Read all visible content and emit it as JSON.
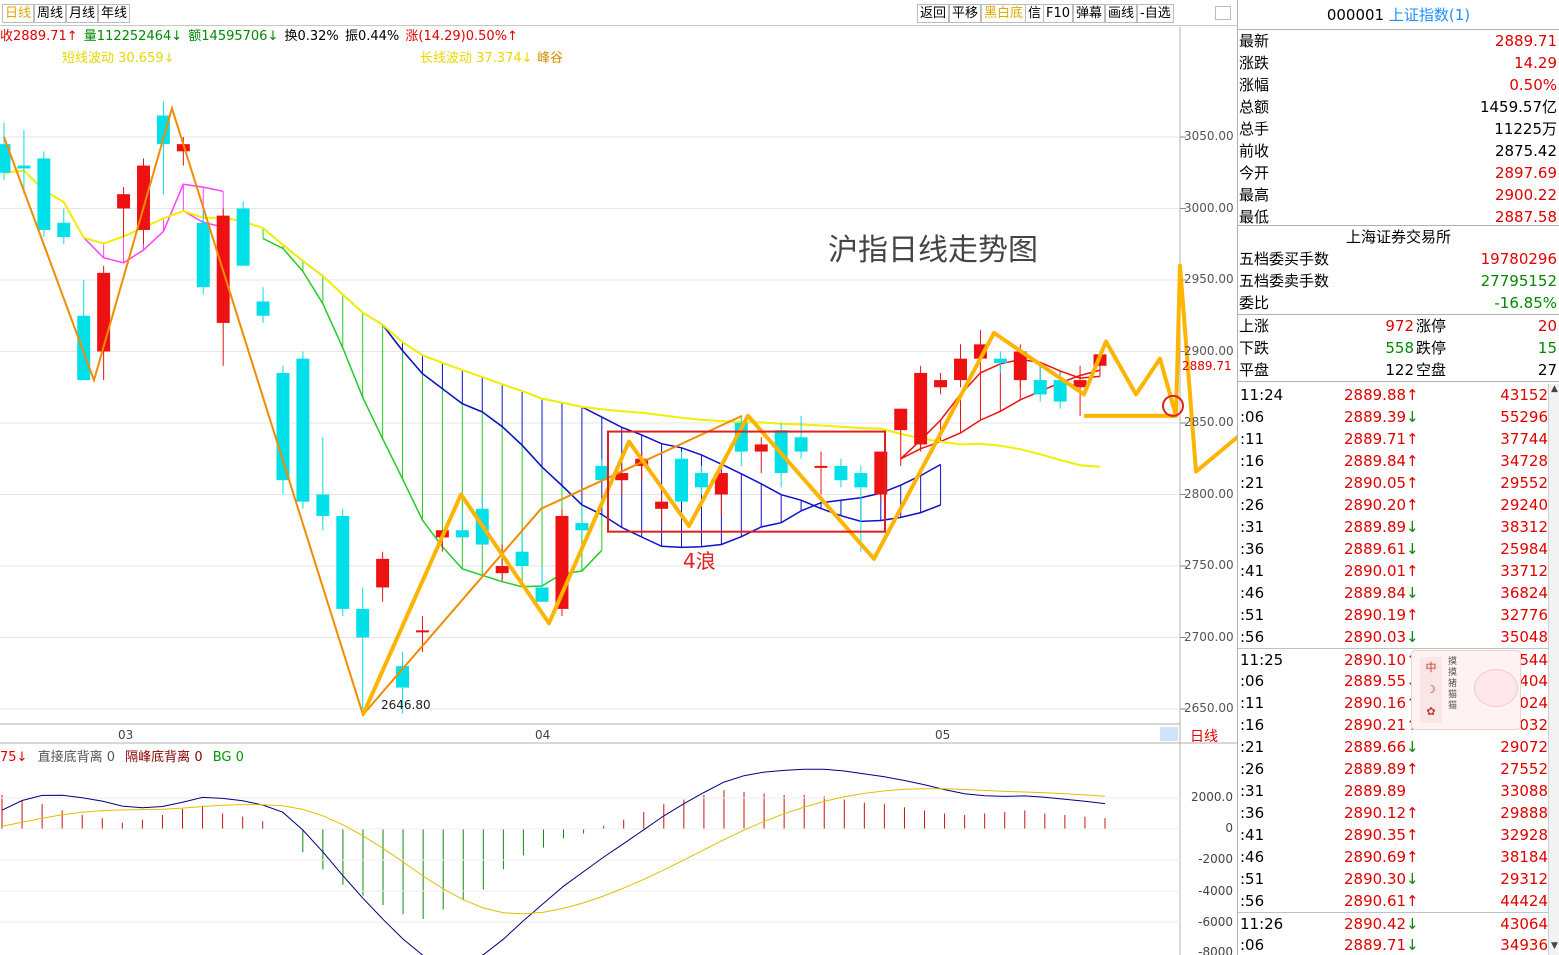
{
  "toolbar": {
    "period_tabs": [
      "日线",
      "周线",
      "月线",
      "年线"
    ],
    "active_tab": 0,
    "tools": [
      "返回",
      "平移",
      "黑白底",
      "信",
      "F10",
      "弹幕",
      "画线",
      "-自选"
    ]
  },
  "info_line": {
    "close": "收2889.71↑",
    "volume": "量112252464↓",
    "amount": "额14595706↓",
    "turnover": "换0.32%",
    "amplitude": "振0.44%",
    "change": "涨(14.29)0.50%↑"
  },
  "wave_line": {
    "short_wave": "短线波动 30.659↓",
    "long_wave": "长线波动 37.374↓",
    "peak_valley": "峰谷"
  },
  "annotations": {
    "title": "沪指日线走势图",
    "wave4": "4浪",
    "low_value": "2646.80",
    "last_price": "2889.71"
  },
  "y_axis": [
    "3050.00",
    "3000.00",
    "2950.00",
    "2900.00",
    "2850.00",
    "2800.00",
    "2750.00",
    "2700.00",
    "2650.00"
  ],
  "x_axis": [
    "03",
    "04",
    "05"
  ],
  "period_tag": "日线",
  "macd_legend": {
    "m1": "75↓",
    "m2": "直接底背离",
    "m2_val": "0",
    "m3": "隔峰底背离",
    "m3_val": "0",
    "m4": "BG",
    "m4_val": "0"
  },
  "macd_axis": [
    "2000.0",
    "0",
    "-2000",
    "-4000",
    "-6000",
    "-8000"
  ],
  "quote": {
    "code": "000001",
    "name": "上证指数(1)",
    "rows": [
      {
        "label": "最新",
        "value": "2889.71",
        "color": "#e00000"
      },
      {
        "label": "涨跌",
        "value": "14.29",
        "color": "#e00000"
      },
      {
        "label": "涨幅",
        "value": "0.50%",
        "color": "#e00000"
      },
      {
        "label": "总额",
        "value": "1459.57亿",
        "color": "#000000"
      },
      {
        "label": "总手",
        "value": "11225万",
        "color": "#000000"
      },
      {
        "label": "前收",
        "value": "2875.42",
        "color": "#000000"
      },
      {
        "label": "今开",
        "value": "2897.69",
        "color": "#e00000"
      },
      {
        "label": "最高",
        "value": "2900.22",
        "color": "#e00000"
      },
      {
        "label": "最低",
        "value": "2887.58",
        "color": "#e00000"
      }
    ],
    "exchange": "上海证券交易所",
    "exchange_rows": [
      {
        "label": "五档委买手数",
        "value": "19780296",
        "color": "#e00000"
      },
      {
        "label": "五档委卖手数",
        "value": "27795152",
        "color": "#008800"
      },
      {
        "label": "委比",
        "value": "-16.85%",
        "color": "#008800"
      }
    ],
    "breadth": [
      {
        "l1": "上涨",
        "v1": "972",
        "c1": "#e00000",
        "l2": "涨停",
        "v2": "20",
        "c2": "#e00000"
      },
      {
        "l1": "下跌",
        "v1": "558",
        "c1": "#008800",
        "l2": "跌停",
        "v2": "15",
        "c2": "#008800"
      },
      {
        "l1": "平盘",
        "v1": "122",
        "c1": "#000000",
        "l2": "空盘",
        "v2": "27",
        "c2": "#000000"
      }
    ]
  },
  "ticks": [
    {
      "time": "11:24",
      "price": "2889.88",
      "dir": "↑",
      "vol": "43152",
      "start": true
    },
    {
      "time": ":06",
      "price": "2889.39",
      "dir": "↓",
      "vol": "55296"
    },
    {
      "time": ":11",
      "price": "2889.71",
      "dir": "↑",
      "vol": "37744"
    },
    {
      "time": ":16",
      "price": "2889.84",
      "dir": "↑",
      "vol": "34728"
    },
    {
      "time": ":21",
      "price": "2890.05",
      "dir": "↑",
      "vol": "29552"
    },
    {
      "time": ":26",
      "price": "2890.20",
      "dir": "↑",
      "vol": "29240"
    },
    {
      "time": ":31",
      "price": "2889.89",
      "dir": "↓",
      "vol": "38312"
    },
    {
      "time": ":36",
      "price": "2889.61",
      "dir": "↓",
      "vol": "25984"
    },
    {
      "time": ":41",
      "price": "2890.01",
      "dir": "↑",
      "vol": "33712"
    },
    {
      "time": ":46",
      "price": "2889.84",
      "dir": "↓",
      "vol": "36824"
    },
    {
      "time": ":51",
      "price": "2890.19",
      "dir": "↑",
      "vol": "32776"
    },
    {
      "time": ":56",
      "price": "2890.03",
      "dir": "↓",
      "vol": "35048"
    },
    {
      "time": "11:25",
      "price": "2890.10",
      "dir": "↑",
      "vol": "40544",
      "start": true
    },
    {
      "time": ":06",
      "price": "2889.55",
      "dir": "↓",
      "vol": "42404"
    },
    {
      "time": ":11",
      "price": "2890.16",
      "dir": "↑",
      "vol": "31024"
    },
    {
      "time": ":16",
      "price": "2890.21",
      "dir": "↑",
      "vol": "34032"
    },
    {
      "time": ":21",
      "price": "2889.66",
      "dir": "↓",
      "vol": "29072"
    },
    {
      "time": ":26",
      "price": "2889.89",
      "dir": "↑",
      "vol": "27552"
    },
    {
      "time": ":31",
      "price": "2889.89",
      "dir": "",
      "vol": "33088"
    },
    {
      "time": ":36",
      "price": "2890.12",
      "dir": "↑",
      "vol": "29888"
    },
    {
      "time": ":41",
      "price": "2890.35",
      "dir": "↑",
      "vol": "32928"
    },
    {
      "time": ":46",
      "price": "2890.69",
      "dir": "↑",
      "vol": "38184"
    },
    {
      "time": ":51",
      "price": "2890.30",
      "dir": "↓",
      "vol": "29312"
    },
    {
      "time": ":56",
      "price": "2890.61",
      "dir": "↑",
      "vol": "44424"
    },
    {
      "time": "11:26",
      "price": "2890.42",
      "dir": "↓",
      "vol": "43064",
      "start": true
    },
    {
      "time": ":06",
      "price": "2889.71",
      "dir": "↓",
      "vol": "34936"
    }
  ],
  "sticker": {
    "tag": "中",
    "text": "摸摸猪猫猫"
  },
  "chart_data": {
    "type": "candlestick",
    "ylim": [
      2630,
      3100
    ],
    "candles": [
      {
        "o": 3045,
        "h": 3060,
        "l": 3020,
        "c": 3025
      },
      {
        "o": 3030,
        "h": 3055,
        "l": 3010,
        "c": 3028
      },
      {
        "o": 3035,
        "h": 3040,
        "l": 2980,
        "c": 2985
      },
      {
        "o": 2990,
        "h": 3000,
        "l": 2975,
        "c": 2980
      },
      {
        "o": 2925,
        "h": 2950,
        "l": 2880,
        "c": 2880
      },
      {
        "o": 2900,
        "h": 2960,
        "l": 2880,
        "c": 2955
      },
      {
        "o": 3000,
        "h": 3015,
        "l": 2980,
        "c": 3010
      },
      {
        "o": 2985,
        "h": 3035,
        "l": 2975,
        "c": 3030
      },
      {
        "o": 3065,
        "h": 3075,
        "l": 3010,
        "c": 3045
      },
      {
        "o": 3040,
        "h": 3050,
        "l": 3030,
        "c": 3045
      },
      {
        "o": 2990,
        "h": 3000,
        "l": 2940,
        "c": 2945
      },
      {
        "o": 2920,
        "h": 3000,
        "l": 2890,
        "c": 2995
      },
      {
        "o": 3000,
        "h": 3005,
        "l": 2960,
        "c": 2960
      },
      {
        "o": 2935,
        "h": 2945,
        "l": 2920,
        "c": 2925
      },
      {
        "o": 2885,
        "h": 2890,
        "l": 2800,
        "c": 2810
      },
      {
        "o": 2895,
        "h": 2900,
        "l": 2790,
        "c": 2795
      },
      {
        "o": 2800,
        "h": 2840,
        "l": 2775,
        "c": 2785
      },
      {
        "o": 2785,
        "h": 2790,
        "l": 2715,
        "c": 2720
      },
      {
        "o": 2720,
        "h": 2735,
        "l": 2650,
        "c": 2700
      },
      {
        "o": 2735,
        "h": 2760,
        "l": 2725,
        "c": 2755
      },
      {
        "o": 2680,
        "h": 2690,
        "l": 2647,
        "c": 2665
      },
      {
        "o": 2705,
        "h": 2715,
        "l": 2690,
        "c": 2705
      },
      {
        "o": 2770,
        "h": 2775,
        "l": 2760,
        "c": 2775
      },
      {
        "o": 2775,
        "h": 2790,
        "l": 2770,
        "c": 2770
      },
      {
        "o": 2790,
        "h": 2800,
        "l": 2775,
        "c": 2765
      },
      {
        "o": 2745,
        "h": 2765,
        "l": 2740,
        "c": 2750
      },
      {
        "o": 2760,
        "h": 2775,
        "l": 2745,
        "c": 2750
      },
      {
        "o": 2735,
        "h": 2750,
        "l": 2725,
        "c": 2725
      },
      {
        "o": 2720,
        "h": 2790,
        "l": 2715,
        "c": 2785
      },
      {
        "o": 2780,
        "h": 2790,
        "l": 2770,
        "c": 2775
      },
      {
        "o": 2820,
        "h": 2825,
        "l": 2810,
        "c": 2810
      },
      {
        "o": 2810,
        "h": 2820,
        "l": 2800,
        "c": 2815
      },
      {
        "o": 2820,
        "h": 2830,
        "l": 2810,
        "c": 2825
      },
      {
        "o": 2790,
        "h": 2800,
        "l": 2780,
        "c": 2795
      },
      {
        "o": 2825,
        "h": 2830,
        "l": 2795,
        "c": 2795
      },
      {
        "o": 2815,
        "h": 2820,
        "l": 2800,
        "c": 2805
      },
      {
        "o": 2800,
        "h": 2815,
        "l": 2785,
        "c": 2815
      },
      {
        "o": 2850,
        "h": 2855,
        "l": 2820,
        "c": 2830
      },
      {
        "o": 2830,
        "h": 2840,
        "l": 2815,
        "c": 2835
      },
      {
        "o": 2845,
        "h": 2850,
        "l": 2805,
        "c": 2815
      },
      {
        "o": 2840,
        "h": 2855,
        "l": 2825,
        "c": 2830
      },
      {
        "o": 2820,
        "h": 2830,
        "l": 2800,
        "c": 2820
      },
      {
        "o": 2820,
        "h": 2825,
        "l": 2805,
        "c": 2810
      },
      {
        "o": 2815,
        "h": 2820,
        "l": 2760,
        "c": 2805
      },
      {
        "o": 2800,
        "h": 2830,
        "l": 2795,
        "c": 2830
      },
      {
        "o": 2845,
        "h": 2860,
        "l": 2820,
        "c": 2860
      },
      {
        "o": 2835,
        "h": 2890,
        "l": 2830,
        "c": 2885
      },
      {
        "o": 2875,
        "h": 2885,
        "l": 2870,
        "c": 2880
      },
      {
        "o": 2880,
        "h": 2905,
        "l": 2875,
        "c": 2895
      },
      {
        "o": 2895,
        "h": 2915,
        "l": 2885,
        "c": 2905
      },
      {
        "o": 2895,
        "h": 2900,
        "l": 2885,
        "c": 2892
      },
      {
        "o": 2880,
        "h": 2905,
        "l": 2875,
        "c": 2900
      },
      {
        "o": 2880,
        "h": 2890,
        "l": 2865,
        "c": 2870
      },
      {
        "o": 2880,
        "h": 2885,
        "l": 2860,
        "c": 2865
      },
      {
        "o": 2875,
        "h": 2890,
        "l": 2855,
        "c": 2880
      },
      {
        "o": 2890,
        "h": 2900,
        "l": 2886,
        "c": 2898
      }
    ],
    "macd_hist": [
      2200,
      1800,
      1600,
      1200,
      900,
      700,
      400,
      600,
      900,
      1300,
      1500,
      1000,
      800,
      500,
      0,
      -1500,
      -2600,
      -3600,
      -4300,
      -4900,
      -5500,
      -5800,
      -5200,
      -4600,
      -3900,
      -2600,
      -1700,
      -1200,
      -600,
      -300,
      200,
      600,
      1100,
      1600,
      1900,
      2200,
      2500,
      2400,
      2300,
      2200,
      2200,
      2100,
      1900,
      1700,
      1600,
      1400,
      1200,
      1000,
      900,
      1000,
      1100,
      1200,
      1000,
      900,
      800,
      700
    ]
  }
}
